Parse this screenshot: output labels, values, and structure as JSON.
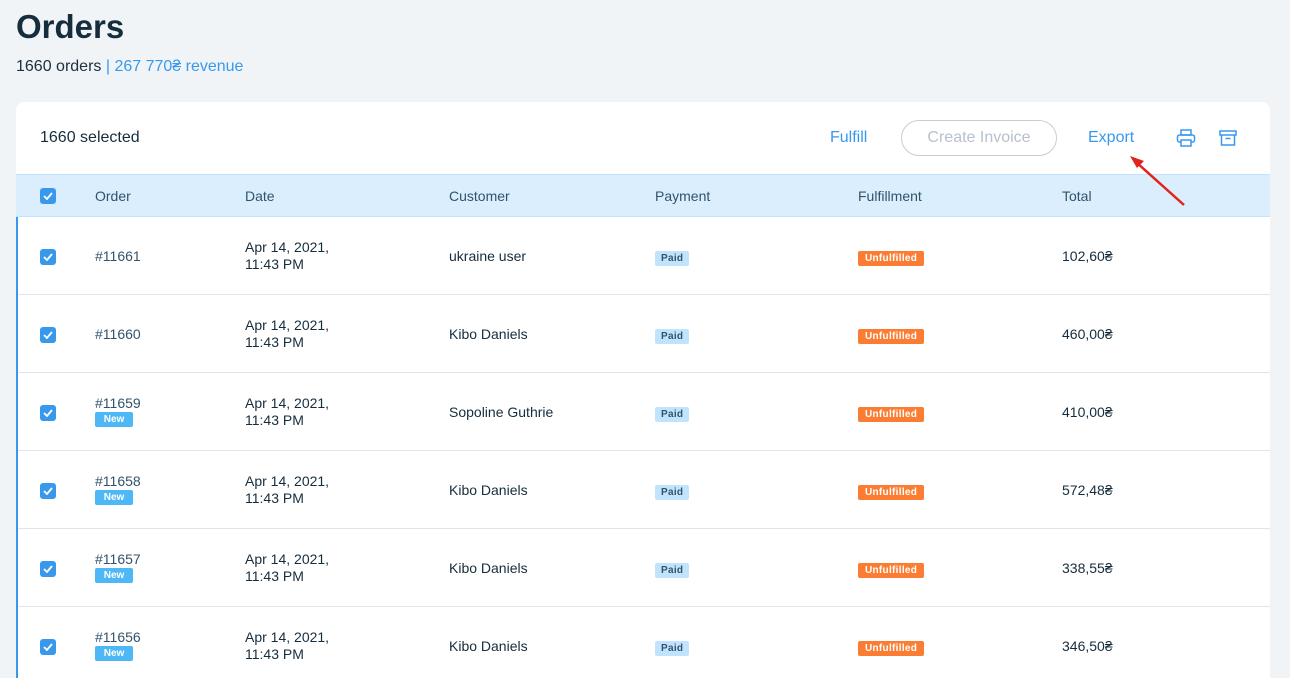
{
  "header": {
    "title": "Orders",
    "orders_count": "1660 orders",
    "separator": " | ",
    "revenue": "267 770₴ revenue"
  },
  "toolbar": {
    "selected": "1660 selected",
    "fulfill": "Fulfill",
    "create_invoice": "Create Invoice",
    "export": "Export",
    "print_icon": "printer-icon",
    "archive_icon": "archive-icon"
  },
  "columns": [
    "Order",
    "Date",
    "Customer",
    "Payment",
    "Fulfillment",
    "Total"
  ],
  "orders": [
    {
      "number": "#11661",
      "new": "",
      "date1": "Apr 14, 2021,",
      "date2": "11:43 PM",
      "customer": "ukraine user",
      "payment": "Paid",
      "fulfillment": "Unfulfilled",
      "total": "102,60₴"
    },
    {
      "number": "#11660",
      "new": "",
      "date1": "Apr 14, 2021,",
      "date2": "11:43 PM",
      "customer": "Kibo Daniels",
      "payment": "Paid",
      "fulfillment": "Unfulfilled",
      "total": "460,00₴"
    },
    {
      "number": "#11659",
      "new": "New",
      "date1": "Apr 14, 2021,",
      "date2": "11:43 PM",
      "customer": "Sopoline Guthrie",
      "payment": "Paid",
      "fulfillment": "Unfulfilled",
      "total": "410,00₴"
    },
    {
      "number": "#11658",
      "new": "New",
      "date1": "Apr 14, 2021,",
      "date2": "11:43 PM",
      "customer": "Kibo Daniels",
      "payment": "Paid",
      "fulfillment": "Unfulfilled",
      "total": "572,48₴"
    },
    {
      "number": "#11657",
      "new": "New",
      "date1": "Apr 14, 2021,",
      "date2": "11:43 PM",
      "customer": "Kibo Daniels",
      "payment": "Paid",
      "fulfillment": "Unfulfilled",
      "total": "338,55₴"
    },
    {
      "number": "#11656",
      "new": "New",
      "date1": "Apr 14, 2021,",
      "date2": "11:43 PM",
      "customer": "Kibo Daniels",
      "payment": "Paid",
      "fulfillment": "Unfulfilled",
      "total": "346,50₴"
    }
  ],
  "colors": {
    "accent": "#3899ec",
    "unfulfilled": "#fb7d33",
    "annotation": "#e2231a"
  }
}
